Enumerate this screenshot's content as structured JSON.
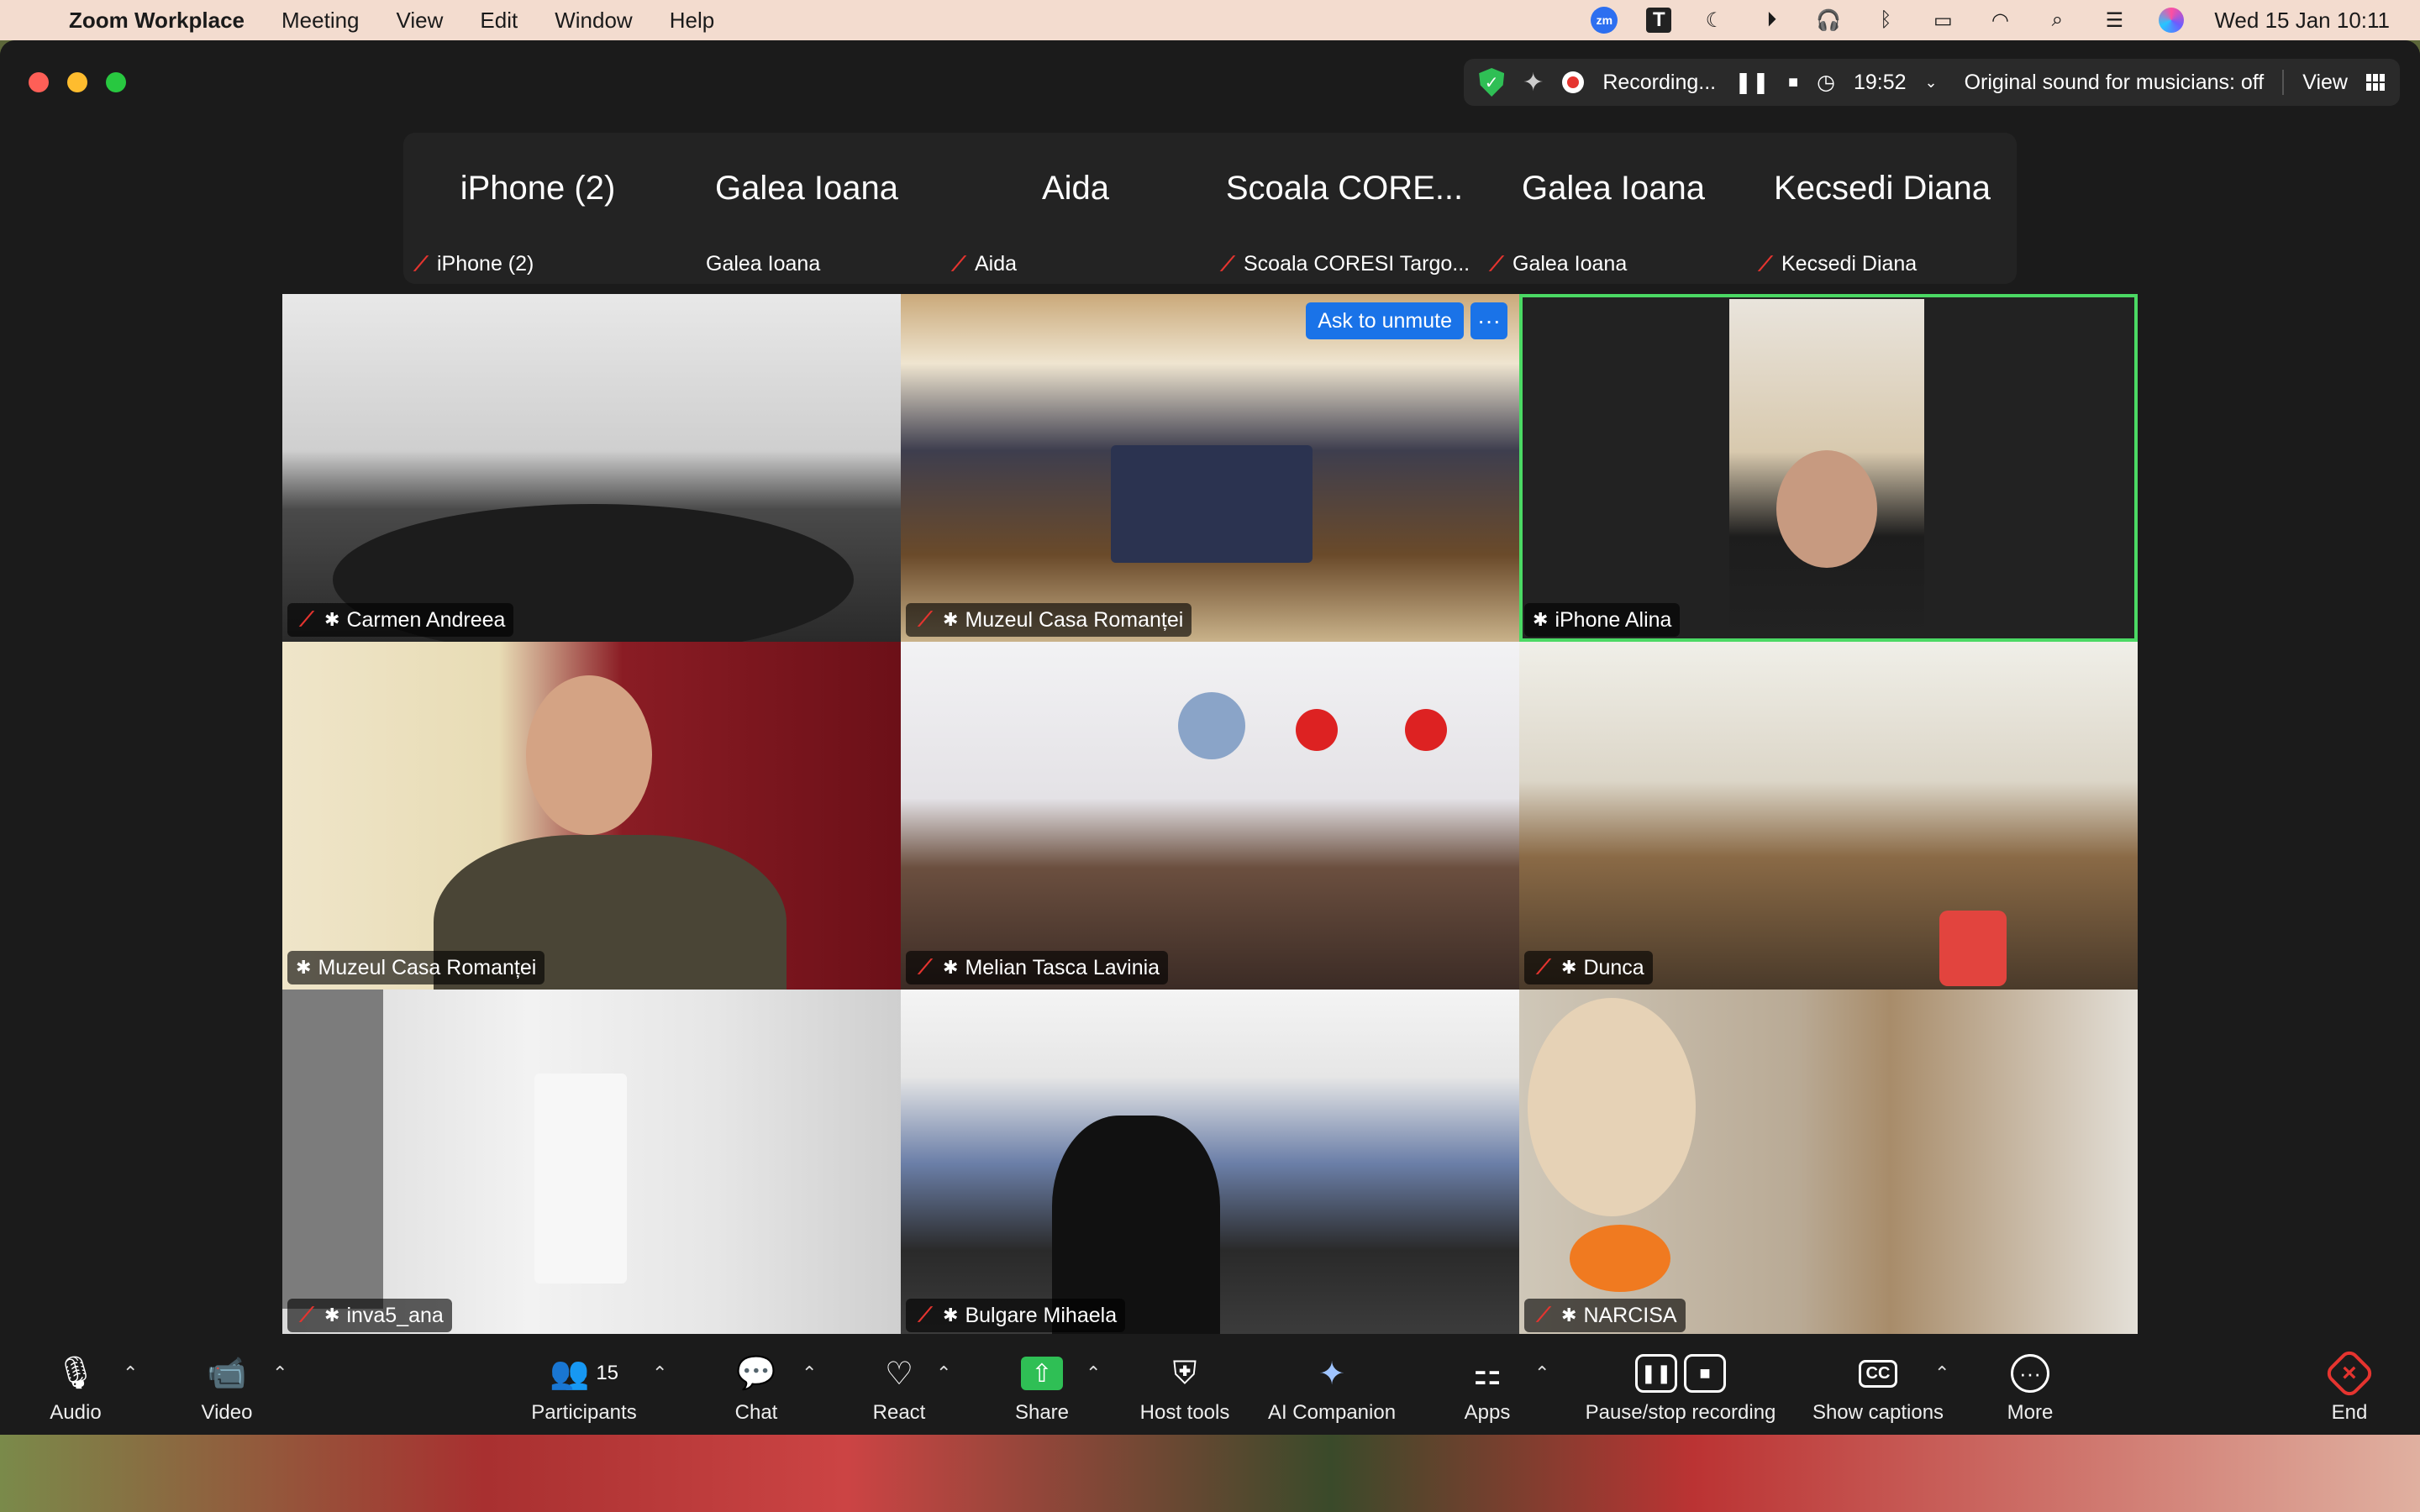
{
  "menubar": {
    "app_name": "Zoom Workplace",
    "menus": [
      "Meeting",
      "View",
      "Edit",
      "Window",
      "Help"
    ],
    "status_icons": [
      "zoom-icon",
      "t-icon",
      "moon-icon",
      "play-icon",
      "headphones-icon",
      "bluetooth-icon",
      "battery-icon",
      "wifi-icon",
      "search-icon",
      "control-center-icon",
      "siri-icon"
    ],
    "zoom_badge": "zm",
    "t_badge": "T",
    "datetime": "Wed 15 Jan  10:11"
  },
  "meeting_status": {
    "recording_label": "Recording...",
    "timer": "19:52",
    "original_sound": "Original sound for musicians: off",
    "view_label": "View"
  },
  "name_strip": [
    {
      "title": "iPhone (2)",
      "label": "iPhone (2)",
      "muted": true
    },
    {
      "title": "Galea Ioana",
      "label": "Galea Ioana",
      "muted": false
    },
    {
      "title": "Aida",
      "label": "Aida",
      "muted": true
    },
    {
      "title": "Scoala CORE...",
      "label": "Scoala CORESI Targo...",
      "muted": true
    },
    {
      "title": "Galea Ioana",
      "label": "Galea Ioana",
      "muted": true
    },
    {
      "title": "Kecsedi Diana",
      "label": "Kecsedi Diana",
      "muted": true
    }
  ],
  "tiles": [
    {
      "name": "Carmen Andreea",
      "muted": true
    },
    {
      "name": "Muzeul Casa Romanței",
      "muted": true,
      "ask_to_unmute": "Ask to unmute",
      "more": "···"
    },
    {
      "name": "iPhone Alina",
      "muted": false,
      "active": true
    },
    {
      "name": "Muzeul Casa Romanței",
      "muted": false
    },
    {
      "name": "Melian Tasca Lavinia",
      "muted": true
    },
    {
      "name": "Dunca",
      "muted": true
    },
    {
      "name": "inva5_ana",
      "muted": true
    },
    {
      "name": "Bulgare Mihaela",
      "muted": true
    },
    {
      "name": "NARCISA",
      "muted": true
    }
  ],
  "toolbar": {
    "audio": "Audio",
    "video": "Video",
    "participants": "Participants",
    "participants_count": "15",
    "chat": "Chat",
    "react": "React",
    "share": "Share",
    "host_tools": "Host tools",
    "ai_companion": "AI Companion",
    "apps": "Apps",
    "pause_stop_recording": "Pause/stop recording",
    "show_captions": "Show captions",
    "cc": "CC",
    "more": "More",
    "end": "End"
  },
  "colors": {
    "accent_blue": "#1a73e8",
    "active_green": "#4bd964",
    "recording_red": "#e5342f",
    "share_green": "#2fbf55"
  }
}
